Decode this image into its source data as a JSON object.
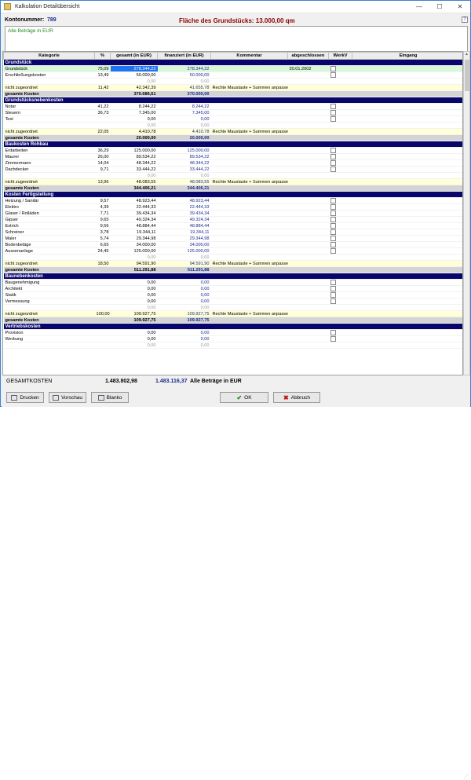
{
  "window": {
    "title": "Kalkulation Detailübersicht",
    "minimize": "—",
    "maximize": "☐",
    "close": "✕"
  },
  "header": {
    "kontonummer_label": "Kontonummer:",
    "kontonummer_value": "789",
    "flaeche": "Fläche des Grundstücks: 13.000,00 qm",
    "help": "?",
    "note": "Alle Beträge in EUR"
  },
  "table": {
    "columns": [
      "Kategorie",
      "%",
      "gesamt (in EUR)",
      "finanziert (in EUR)",
      "Kommentar",
      "abgeschlossen",
      "WerkV",
      "Eingang"
    ],
    "rows": [
      {
        "type": "section",
        "k": "Grundstück"
      },
      {
        "type": "green",
        "k": "Grundstück",
        "p": "75,09",
        "g": "278.344,22",
        "f": "278.344,22",
        "c": "",
        "a": "20.01.2002",
        "w": true,
        "hl": true
      },
      {
        "type": "normal",
        "k": "Erschließungskosten",
        "p": "13,49",
        "g": "50.000,00",
        "f": "50.000,00",
        "c": "",
        "a": "",
        "w": true
      },
      {
        "type": "gray",
        "k": "",
        "p": "",
        "g": "0,00",
        "f": "0,00",
        "c": "",
        "a": "",
        "w": false
      },
      {
        "type": "notassigned",
        "k": "nicht zugeordnet",
        "p": "11,42",
        "g": "42.342,39",
        "f": "41.655,78",
        "c": "Rechte Maustaste + Summen anpassen",
        "a": "",
        "w": false
      },
      {
        "type": "total",
        "k": "gesamte Kosten",
        "p": "",
        "g": "370.686,61",
        "f": "370.000,00",
        "c": "",
        "a": "",
        "w": false
      },
      {
        "type": "section",
        "k": "Grundstücksnebenkosten"
      },
      {
        "type": "normal",
        "k": "Notar",
        "p": "41,22",
        "g": "8.244,22",
        "f": "8.244,22",
        "c": "",
        "a": "",
        "w": true
      },
      {
        "type": "normal",
        "k": "Steuern",
        "p": "36,73",
        "g": "7.345,00",
        "f": "7.345,00",
        "c": "",
        "a": "",
        "w": true
      },
      {
        "type": "normal",
        "k": "Test",
        "p": "",
        "g": "0,00",
        "f": "0,00",
        "c": "",
        "a": "",
        "w": true
      },
      {
        "type": "gray",
        "k": "",
        "p": "",
        "g": "0,00",
        "f": "0,00",
        "c": "",
        "a": "",
        "w": false
      },
      {
        "type": "notassigned",
        "k": "nicht zugeordnet",
        "p": "22,05",
        "g": "4.410,78",
        "f": "4.410,78",
        "c": "Rechte Maustaste + Summen anpassen",
        "a": "",
        "w": false
      },
      {
        "type": "total",
        "k": "gesamte Kosten",
        "p": "",
        "g": "20.000,00",
        "f": "20.000,00",
        "c": "",
        "a": "",
        "w": false
      },
      {
        "type": "section",
        "k": "Baukosten Rohbau"
      },
      {
        "type": "normal",
        "k": "Erdarbeiten",
        "p": "36,29",
        "g": "125.000,00",
        "f": "125.000,00",
        "c": "",
        "a": "",
        "w": true
      },
      {
        "type": "normal",
        "k": "Maurer",
        "p": "26,00",
        "g": "89.534,22",
        "f": "89.534,22",
        "c": "",
        "a": "",
        "w": true
      },
      {
        "type": "normal",
        "k": "Zimmermann",
        "p": "14,04",
        "g": "48.344,22",
        "f": "48.344,22",
        "c": "",
        "a": "",
        "w": true
      },
      {
        "type": "normal",
        "k": "Dachdecker",
        "p": "9,71",
        "g": "33.444,22",
        "f": "33.444,22",
        "c": "",
        "a": "",
        "w": true
      },
      {
        "type": "gray",
        "k": "",
        "p": "",
        "g": "0,00",
        "f": "0,00",
        "c": "",
        "a": "",
        "w": false
      },
      {
        "type": "notassigned",
        "k": "nicht zugeordnet",
        "p": "13,96",
        "g": "48.083,55",
        "f": "48.083,55",
        "c": "Rechte Maustaste + Summen anpassen",
        "a": "",
        "w": false
      },
      {
        "type": "total",
        "k": "gesamte Kosten",
        "p": "",
        "g": "344.406,21",
        "f": "344.406,21",
        "c": "",
        "a": "",
        "w": false
      },
      {
        "type": "section",
        "k": "Kosten Fertigstellung"
      },
      {
        "type": "normal",
        "k": "Heizung / Sanitär",
        "p": "9,57",
        "g": "48.923,44",
        "f": "48.923,44",
        "c": "",
        "a": "",
        "w": true
      },
      {
        "type": "normal",
        "k": "Elektro",
        "p": "4,39",
        "g": "22.444,33",
        "f": "22.444,33",
        "c": "",
        "a": "",
        "w": true
      },
      {
        "type": "normal",
        "k": "Glaser / Rolläden",
        "p": "7,71",
        "g": "39.434,34",
        "f": "39.434,34",
        "c": "",
        "a": "",
        "w": true
      },
      {
        "type": "normal",
        "k": "Gipser",
        "p": "9,65",
        "g": "49.324,34",
        "f": "49.324,34",
        "c": "",
        "a": "",
        "w": true
      },
      {
        "type": "normal",
        "k": "Estrich",
        "p": "9,56",
        "g": "48.884,44",
        "f": "48.884,44",
        "c": "",
        "a": "",
        "w": true
      },
      {
        "type": "normal",
        "k": "Schreiner",
        "p": "3,78",
        "g": "19.344,11",
        "f": "19.344,11",
        "c": "",
        "a": "",
        "w": true
      },
      {
        "type": "normal",
        "k": "Maler",
        "p": "5,74",
        "g": "29.344,98",
        "f": "29.344,98",
        "c": "",
        "a": "",
        "w": true
      },
      {
        "type": "normal",
        "k": "Bodenbeläge",
        "p": "6,65",
        "g": "34.000,00",
        "f": "34.000,00",
        "c": "",
        "a": "",
        "w": true
      },
      {
        "type": "normal",
        "k": "Aussenanlage",
        "p": "24,45",
        "g": "125.000,00",
        "f": "125.000,00",
        "c": "",
        "a": "",
        "w": true
      },
      {
        "type": "gray",
        "k": "",
        "p": "",
        "g": "0,00",
        "f": "0,00",
        "c": "",
        "a": "",
        "w": false
      },
      {
        "type": "notassigned",
        "k": "nicht zugeordnet",
        "p": "18,50",
        "g": "94.591,90",
        "f": "94.591,90",
        "c": "Rechte Maustaste + Summen anpassen",
        "a": "",
        "w": false
      },
      {
        "type": "total",
        "k": "gesamte Kosten",
        "p": "",
        "g": "511.291,88",
        "f": "511.291,88",
        "c": "",
        "a": "",
        "w": false
      },
      {
        "type": "section",
        "k": "Baunebenkosten"
      },
      {
        "type": "normal",
        "k": "Baugenehmigung",
        "p": "",
        "g": "0,00",
        "f": "0,00",
        "c": "",
        "a": "",
        "w": true
      },
      {
        "type": "normal",
        "k": "Architekt",
        "p": "",
        "g": "0,00",
        "f": "0,00",
        "c": "",
        "a": "",
        "w": true
      },
      {
        "type": "normal",
        "k": "Statik",
        "p": "",
        "g": "0,00",
        "f": "0,00",
        "c": "",
        "a": "",
        "w": true
      },
      {
        "type": "normal",
        "k": "Vermessung",
        "p": "",
        "g": "0,00",
        "f": "0,00",
        "c": "",
        "a": "",
        "w": true
      },
      {
        "type": "gray",
        "k": "",
        "p": "",
        "g": "0,00",
        "f": "0,00",
        "c": "",
        "a": "",
        "w": false
      },
      {
        "type": "notassigned",
        "k": "nicht zugeordnet",
        "p": "100,00",
        "g": "109.927,75",
        "f": "109.927,75",
        "c": "Rechte Maustaste + Summen anpassen",
        "a": "",
        "w": false
      },
      {
        "type": "total",
        "k": "gesamte Kosten",
        "p": "",
        "g": "109.927,75",
        "f": "109.927,75",
        "c": "",
        "a": "",
        "w": false
      },
      {
        "type": "section",
        "k": "Vertriebskosten"
      },
      {
        "type": "normal",
        "k": "Provision",
        "p": "",
        "g": "0,00",
        "f": "0,00",
        "c": "",
        "a": "",
        "w": true
      },
      {
        "type": "normal",
        "k": "Werbung",
        "p": "",
        "g": "0,00",
        "f": "0,00",
        "c": "",
        "a": "",
        "w": true
      },
      {
        "type": "gray",
        "k": "",
        "p": "",
        "g": "0,00",
        "f": "0,00",
        "c": "",
        "a": "",
        "w": false
      }
    ]
  },
  "footer": {
    "gesamtkosten_label": "GESAMTKOSTEN",
    "gesamt": "1.483.802,98",
    "finanziert": "1.483.116,37",
    "note": "Alle Beträge in EUR",
    "buttons": {
      "drucken": "Drucken",
      "vorschau": "Vorschau",
      "blanko": "Blanko",
      "ok": "OK",
      "abbruch": "Abbruch"
    }
  }
}
